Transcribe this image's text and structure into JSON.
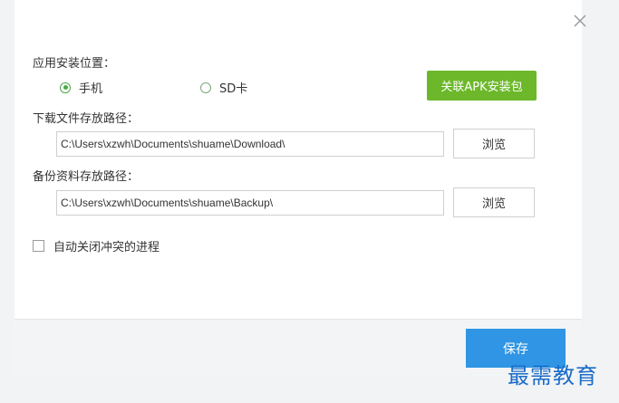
{
  "install_location": {
    "title": "应用安装位置：",
    "options": [
      {
        "label": "手机",
        "selected": true
      },
      {
        "label": "SD卡",
        "selected": false
      }
    ],
    "associate_apk_button": "关联APK安装包"
  },
  "download_path": {
    "title": "下载文件存放路径：",
    "value": "C:\\Users\\xzwh\\Documents\\shuame\\Download\\",
    "browse_label": "浏览"
  },
  "backup_path": {
    "title": "备份资料存放路径：",
    "value": "C:\\Users\\xzwh\\Documents\\shuame\\Backup\\",
    "browse_label": "浏览"
  },
  "auto_close": {
    "label": "自动关闭冲突的进程",
    "checked": false
  },
  "footer": {
    "save_label": "保存"
  },
  "watermark": "最需教育",
  "colors": {
    "apk_button": "#6cb82a",
    "save_button": "#2f95e4",
    "radio_selected": "#49a843",
    "watermark": "#1a6cc9"
  },
  "icons": {
    "close": "close-icon"
  }
}
